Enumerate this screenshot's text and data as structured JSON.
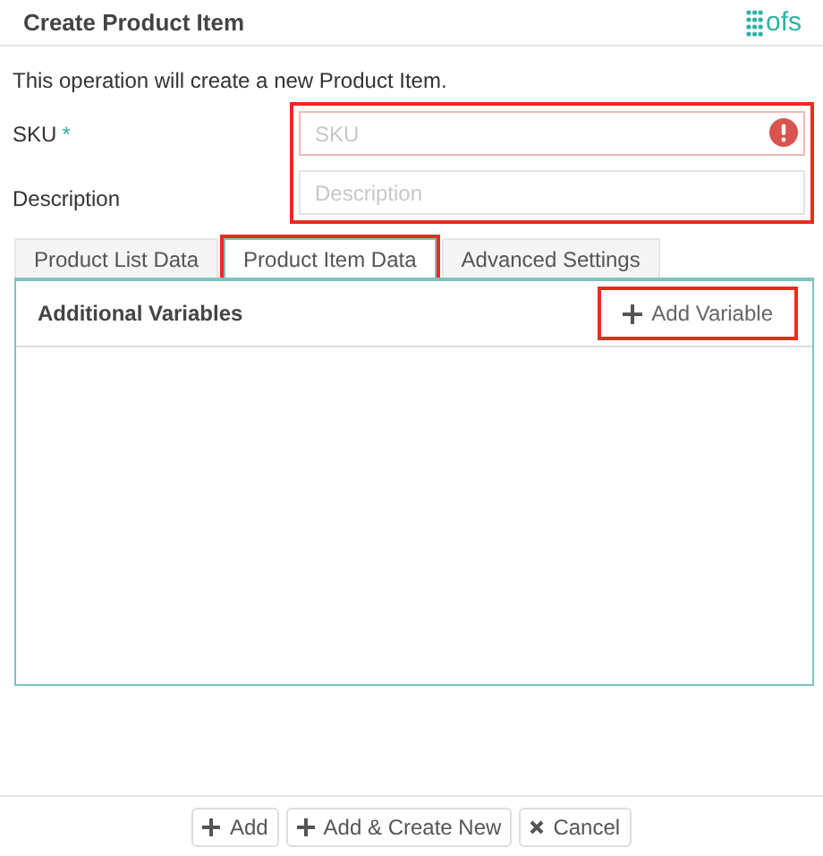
{
  "window": {
    "title": "Create Product Item",
    "logo": "ofs"
  },
  "intro": "This operation will create a new Product Item.",
  "form": {
    "highlighted": true,
    "fields": [
      {
        "label": "SKU",
        "required_mark": "*",
        "placeholder": "SKU",
        "error": true
      },
      {
        "label": "Description",
        "placeholder": "Description",
        "error": false
      }
    ]
  },
  "tabs": [
    {
      "label": "Product List Data",
      "selected": false,
      "highlighted": false
    },
    {
      "label": "Product Item Data",
      "selected": true,
      "highlighted": true
    },
    {
      "label": "Advanced Settings",
      "selected": false,
      "highlighted": false
    }
  ],
  "panel": {
    "title": "Additional Variables",
    "action": {
      "label": "Add Variable",
      "highlighted": true
    }
  },
  "buttons": [
    {
      "label": "Add",
      "kind": "plus"
    },
    {
      "label": "Add & Create New",
      "kind": "plus"
    },
    {
      "label": "Cancel",
      "kind": "cross"
    }
  ]
}
